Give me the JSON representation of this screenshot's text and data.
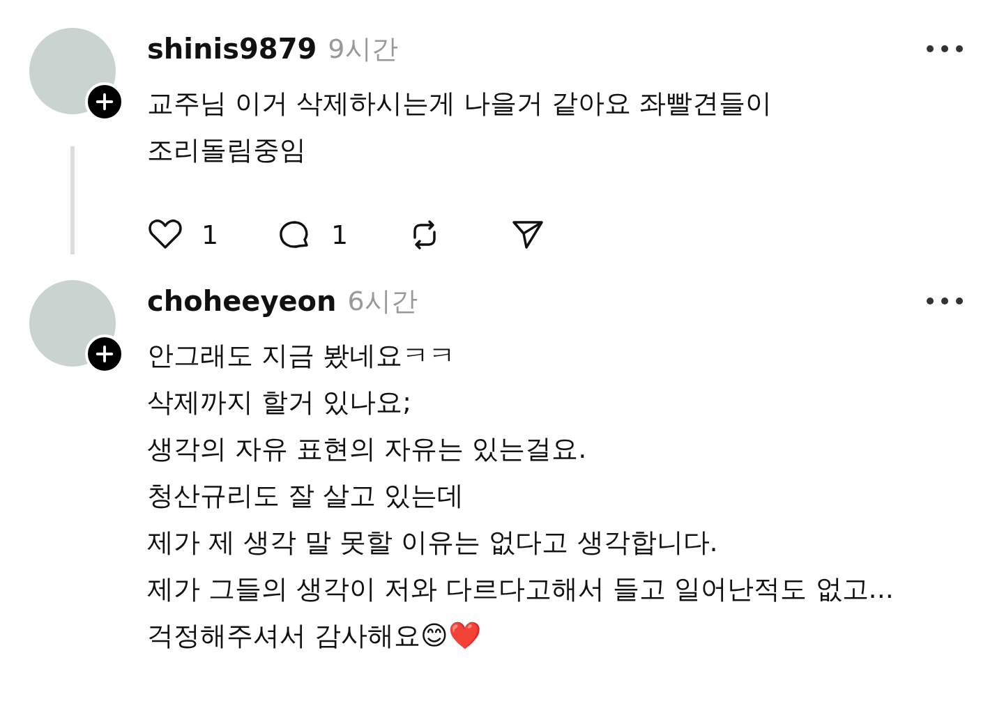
{
  "comments": [
    {
      "username": "shinis9879",
      "time": "9시간",
      "thread_line": true,
      "lines": [
        "교주님 이거 삭제하시는게 나을거 같아요 좌빨견들이",
        "조리돌림중임"
      ],
      "actions": [
        {
          "kind": "like",
          "count": "1"
        },
        {
          "kind": "reply",
          "count": "1"
        },
        {
          "kind": "repost"
        },
        {
          "kind": "share"
        }
      ]
    },
    {
      "username": "choheeyeon",
      "time": "6시간",
      "thread_line": false,
      "lines": [
        "안그래도 지금 봤네요ㅋㅋ",
        "삭제까지 할거 있나요;",
        "생각의 자유 표현의 자유는 있는걸요.",
        "청산규리도 잘 살고 있는데",
        "제가 제 생각 말 못할 이유는 없다고 생각합니다.",
        "제가 그들의 생각이 저와 다르다고해서 들고 일어난적도 없고...",
        "걱정해주셔서 감사해요😊❤️"
      ]
    }
  ]
}
